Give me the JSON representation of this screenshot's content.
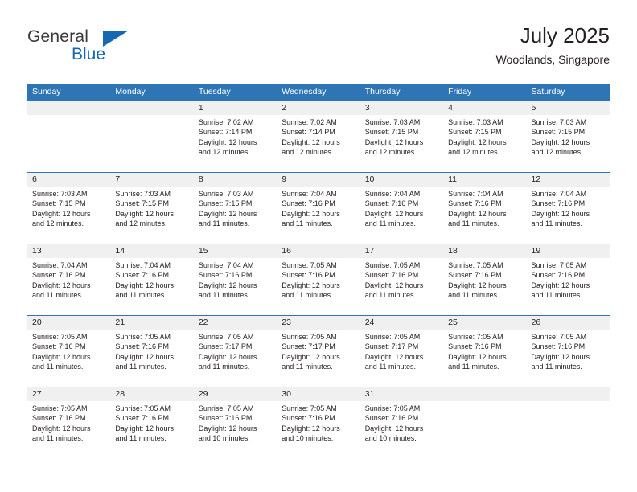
{
  "brand": {
    "name_top": "General",
    "name_bottom": "Blue",
    "accent_color": "#1668b3",
    "triangle_icon": "triangle-icon"
  },
  "header": {
    "title": "July 2025",
    "subtitle": "Woodlands, Singapore"
  },
  "calendar": {
    "header_bg": "#2e75b6",
    "row_border_color": "#2e75b6",
    "day_band_bg": "#f0f0f0",
    "weekdays": [
      "Sunday",
      "Monday",
      "Tuesday",
      "Wednesday",
      "Thursday",
      "Friday",
      "Saturday"
    ],
    "weeks": [
      [
        {
          "day": "",
          "lines": []
        },
        {
          "day": "",
          "lines": []
        },
        {
          "day": "1",
          "lines": [
            "Sunrise: 7:02 AM",
            "Sunset: 7:14 PM",
            "Daylight: 12 hours",
            "and 12 minutes."
          ]
        },
        {
          "day": "2",
          "lines": [
            "Sunrise: 7:02 AM",
            "Sunset: 7:14 PM",
            "Daylight: 12 hours",
            "and 12 minutes."
          ]
        },
        {
          "day": "3",
          "lines": [
            "Sunrise: 7:03 AM",
            "Sunset: 7:15 PM",
            "Daylight: 12 hours",
            "and 12 minutes."
          ]
        },
        {
          "day": "4",
          "lines": [
            "Sunrise: 7:03 AM",
            "Sunset: 7:15 PM",
            "Daylight: 12 hours",
            "and 12 minutes."
          ]
        },
        {
          "day": "5",
          "lines": [
            "Sunrise: 7:03 AM",
            "Sunset: 7:15 PM",
            "Daylight: 12 hours",
            "and 12 minutes."
          ]
        }
      ],
      [
        {
          "day": "6",
          "lines": [
            "Sunrise: 7:03 AM",
            "Sunset: 7:15 PM",
            "Daylight: 12 hours",
            "and 12 minutes."
          ]
        },
        {
          "day": "7",
          "lines": [
            "Sunrise: 7:03 AM",
            "Sunset: 7:15 PM",
            "Daylight: 12 hours",
            "and 12 minutes."
          ]
        },
        {
          "day": "8",
          "lines": [
            "Sunrise: 7:03 AM",
            "Sunset: 7:15 PM",
            "Daylight: 12 hours",
            "and 11 minutes."
          ]
        },
        {
          "day": "9",
          "lines": [
            "Sunrise: 7:04 AM",
            "Sunset: 7:16 PM",
            "Daylight: 12 hours",
            "and 11 minutes."
          ]
        },
        {
          "day": "10",
          "lines": [
            "Sunrise: 7:04 AM",
            "Sunset: 7:16 PM",
            "Daylight: 12 hours",
            "and 11 minutes."
          ]
        },
        {
          "day": "11",
          "lines": [
            "Sunrise: 7:04 AM",
            "Sunset: 7:16 PM",
            "Daylight: 12 hours",
            "and 11 minutes."
          ]
        },
        {
          "day": "12",
          "lines": [
            "Sunrise: 7:04 AM",
            "Sunset: 7:16 PM",
            "Daylight: 12 hours",
            "and 11 minutes."
          ]
        }
      ],
      [
        {
          "day": "13",
          "lines": [
            "Sunrise: 7:04 AM",
            "Sunset: 7:16 PM",
            "Daylight: 12 hours",
            "and 11 minutes."
          ]
        },
        {
          "day": "14",
          "lines": [
            "Sunrise: 7:04 AM",
            "Sunset: 7:16 PM",
            "Daylight: 12 hours",
            "and 11 minutes."
          ]
        },
        {
          "day": "15",
          "lines": [
            "Sunrise: 7:04 AM",
            "Sunset: 7:16 PM",
            "Daylight: 12 hours",
            "and 11 minutes."
          ]
        },
        {
          "day": "16",
          "lines": [
            "Sunrise: 7:05 AM",
            "Sunset: 7:16 PM",
            "Daylight: 12 hours",
            "and 11 minutes."
          ]
        },
        {
          "day": "17",
          "lines": [
            "Sunrise: 7:05 AM",
            "Sunset: 7:16 PM",
            "Daylight: 12 hours",
            "and 11 minutes."
          ]
        },
        {
          "day": "18",
          "lines": [
            "Sunrise: 7:05 AM",
            "Sunset: 7:16 PM",
            "Daylight: 12 hours",
            "and 11 minutes."
          ]
        },
        {
          "day": "19",
          "lines": [
            "Sunrise: 7:05 AM",
            "Sunset: 7:16 PM",
            "Daylight: 12 hours",
            "and 11 minutes."
          ]
        }
      ],
      [
        {
          "day": "20",
          "lines": [
            "Sunrise: 7:05 AM",
            "Sunset: 7:16 PM",
            "Daylight: 12 hours",
            "and 11 minutes."
          ]
        },
        {
          "day": "21",
          "lines": [
            "Sunrise: 7:05 AM",
            "Sunset: 7:16 PM",
            "Daylight: 12 hours",
            "and 11 minutes."
          ]
        },
        {
          "day": "22",
          "lines": [
            "Sunrise: 7:05 AM",
            "Sunset: 7:17 PM",
            "Daylight: 12 hours",
            "and 11 minutes."
          ]
        },
        {
          "day": "23",
          "lines": [
            "Sunrise: 7:05 AM",
            "Sunset: 7:17 PM",
            "Daylight: 12 hours",
            "and 11 minutes."
          ]
        },
        {
          "day": "24",
          "lines": [
            "Sunrise: 7:05 AM",
            "Sunset: 7:17 PM",
            "Daylight: 12 hours",
            "and 11 minutes."
          ]
        },
        {
          "day": "25",
          "lines": [
            "Sunrise: 7:05 AM",
            "Sunset: 7:16 PM",
            "Daylight: 12 hours",
            "and 11 minutes."
          ]
        },
        {
          "day": "26",
          "lines": [
            "Sunrise: 7:05 AM",
            "Sunset: 7:16 PM",
            "Daylight: 12 hours",
            "and 11 minutes."
          ]
        }
      ],
      [
        {
          "day": "27",
          "lines": [
            "Sunrise: 7:05 AM",
            "Sunset: 7:16 PM",
            "Daylight: 12 hours",
            "and 11 minutes."
          ]
        },
        {
          "day": "28",
          "lines": [
            "Sunrise: 7:05 AM",
            "Sunset: 7:16 PM",
            "Daylight: 12 hours",
            "and 11 minutes."
          ]
        },
        {
          "day": "29",
          "lines": [
            "Sunrise: 7:05 AM",
            "Sunset: 7:16 PM",
            "Daylight: 12 hours",
            "and 10 minutes."
          ]
        },
        {
          "day": "30",
          "lines": [
            "Sunrise: 7:05 AM",
            "Sunset: 7:16 PM",
            "Daylight: 12 hours",
            "and 10 minutes."
          ]
        },
        {
          "day": "31",
          "lines": [
            "Sunrise: 7:05 AM",
            "Sunset: 7:16 PM",
            "Daylight: 12 hours",
            "and 10 minutes."
          ]
        },
        {
          "day": "",
          "lines": []
        },
        {
          "day": "",
          "lines": []
        }
      ]
    ]
  }
}
